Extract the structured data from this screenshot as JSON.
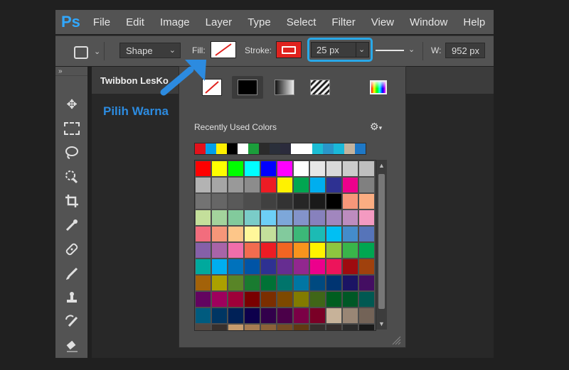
{
  "menubar": {
    "logo": "Ps",
    "items": [
      "File",
      "Edit",
      "Image",
      "Layer",
      "Type",
      "Select",
      "Filter",
      "View",
      "Window",
      "Help"
    ]
  },
  "options": {
    "mode": "Shape",
    "fill_label": "Fill:",
    "stroke_label": "Stroke:",
    "stroke_width": "25 px",
    "width_label": "W:",
    "width_value": "952 px"
  },
  "document": {
    "tab_title": "Twibbon LesKo",
    "annotation": "Pilih Warna"
  },
  "popup": {
    "recent_label": "Recently Used Colors",
    "recent_colors": [
      "#e3111b",
      "#00a0e9",
      "#fff000",
      "#000000",
      "#ffffff",
      "#1b9e3b",
      "#2b2b2b",
      "#2a2f3a",
      "#2b2b3c",
      "#ffffff",
      "#ffffff",
      "#1bbdd4",
      "#2a96c9",
      "#1ab9d9",
      "#c3b39e",
      "#1e78c6"
    ],
    "swatches": [
      [
        "#ff0000",
        "#ffff00",
        "#00ff00",
        "#00ffff",
        "#0000ff",
        "#ff00ff",
        "#ffffff",
        "#e6e6e6",
        "#d9d9d9",
        "#cccccc",
        "#bfbfbf"
      ],
      [
        "#b3b3b3",
        "#a6a6a6",
        "#999999",
        "#8c8c8c",
        "#ed1c24",
        "#fff200",
        "#00a651",
        "#00aeef",
        "#2e3192",
        "#ec008c",
        "#808080"
      ],
      [
        "#737373",
        "#666666",
        "#595959",
        "#4d4d4d",
        "#404040",
        "#333333",
        "#262626",
        "#1a1a1a",
        "#000000",
        "#f7977a",
        "#fbad82"
      ],
      [
        "#c4df9b",
        "#a3d39c",
        "#82ca9c",
        "#7accc8",
        "#6dcff6",
        "#7da7d9",
        "#8393ca",
        "#8781bd",
        "#a186be",
        "#bd8cbf",
        "#f49ac1"
      ],
      [
        "#f26d7d",
        "#f69679",
        "#fdc689",
        "#fff79a",
        "#c4df9b",
        "#82ca9d",
        "#3cb878",
        "#1cbbb4",
        "#00bff3",
        "#448ccb",
        "#5674b9"
      ],
      [
        "#8560a8",
        "#a864a8",
        "#f06eaa",
        "#f26c4f",
        "#ed1c24",
        "#f26522",
        "#f7941d",
        "#fff200",
        "#8dc63f",
        "#39b54a",
        "#00a651"
      ],
      [
        "#00a99d",
        "#00aeef",
        "#0072bc",
        "#0054a6",
        "#2e3192",
        "#662d91",
        "#92278f",
        "#ec008c",
        "#ed145b",
        "#9e0b0f",
        "#a0410d"
      ],
      [
        "#a36209",
        "#aba000",
        "#598527",
        "#197b30",
        "#007236",
        "#00746b",
        "#0076a3",
        "#004a80",
        "#003471",
        "#1b1464",
        "#440e62"
      ],
      [
        "#630460",
        "#9e005d",
        "#9e0039",
        "#790000",
        "#7b2e00",
        "#7d4900",
        "#827b00",
        "#406618",
        "#005e20",
        "#005826",
        "#005952"
      ],
      [
        "#005b7f",
        "#003663",
        "#002157",
        "#0d004c",
        "#32004b",
        "#4b0049",
        "#7b0046",
        "#7a0026",
        "#c7b299",
        "#998675",
        "#736357"
      ],
      [
        "#534741",
        "#37302d",
        "#c69c6d",
        "#a67c52",
        "#8c6239",
        "#754c24",
        "#603913",
        "#362f2d",
        "#362f2d",
        "#2b2b2b",
        "#1a1a1a"
      ]
    ]
  }
}
